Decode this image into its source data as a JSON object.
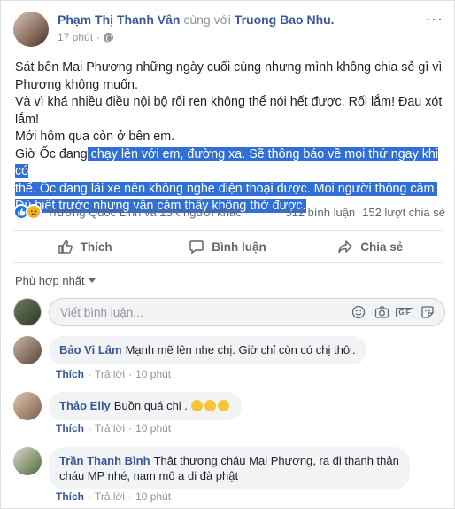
{
  "post": {
    "author": "Phạm Thị Thanh Vân",
    "with_text": "cùng với",
    "with_name": "Truong Bao Nhu.",
    "time": "17 phút",
    "more": "···",
    "para1": "Sát bên Mai Phương những ngày cuối cùng nhưng mình không chia sẻ gì vì Phương không muốn.",
    "para2": "Và vì khá nhiều điều nội bộ rối ren không thể nói hết được. Rối lắm! Đau xót lắm!",
    "para3": "Mới hôm qua còn ở bên em.",
    "para4_prefix": "Giờ Ốc đang",
    "para4_highlight_1": " chạy lên với em, đường xa. Sẽ thông báo về mọi thứ ngay khi có",
    "para4_highlight_2": "thể. Ốc đang lái xe nên không nghe điện thoại được. Mọi người thông cảm.",
    "para4_highlight_3": "Dù biết trước nhưng vẫn cảm thấy không thở được."
  },
  "reactions": {
    "names": "Trương Quốc Linh và 13K người khác",
    "comments": "512 bình luận",
    "shares": "152 lượt chia sẻ"
  },
  "actions": {
    "like": "Thích",
    "comment": "Bình luận",
    "share": "Chia sẻ"
  },
  "filter": {
    "label": "Phù hợp nhất"
  },
  "composer": {
    "placeholder": "Viết bình luận..."
  },
  "comments": [
    {
      "name": "Bảo Vi Lâm",
      "text": "Mạnh mẽ lên nhe chị. Giờ chỉ còn có chị thôi.",
      "like": "Thích",
      "reply": "Trả lời",
      "time": "10 phút"
    },
    {
      "name": "Thảo Elly",
      "text": "Buồn quá chị .",
      "like": "Thích",
      "reply": "Trả lời",
      "time": "10 phút"
    },
    {
      "name": "Trần Thanh Bình",
      "text_line1": "Thật thương cháu Mai Phương, ra đi thanh thản",
      "text_line2": "cháu MP nhé, nam mô a di đà phật",
      "like": "Thích",
      "reply": "Trả lời",
      "time": "10 phút"
    }
  ],
  "colors": {
    "link": "#385898",
    "highlight": "#2f6fd6",
    "muted": "#90949c"
  }
}
